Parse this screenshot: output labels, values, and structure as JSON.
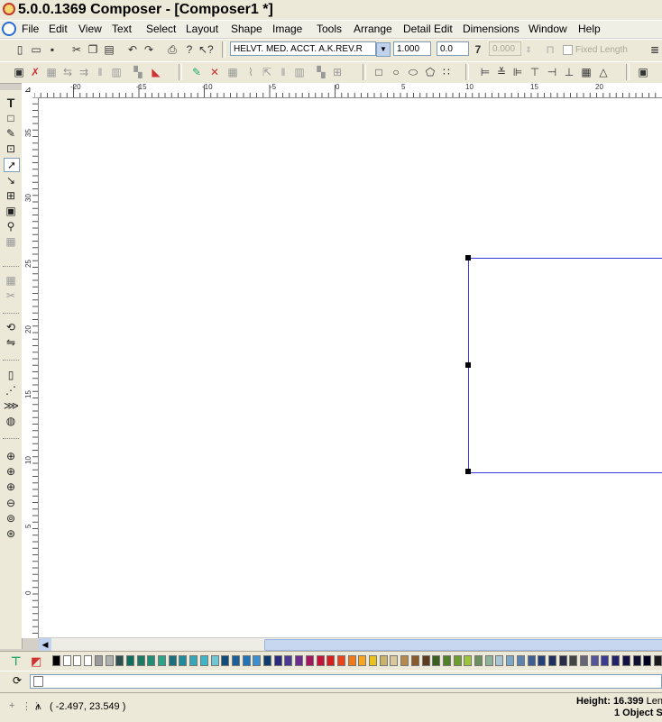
{
  "window": {
    "title": "5.0.0.1369 Composer - [Composer1 *]"
  },
  "menu": [
    "File",
    "Edit",
    "View",
    "Text",
    "Select",
    "Layout",
    "Shape",
    "Image",
    "Tools",
    "Arrange",
    "Detail Edit",
    "Dimensions",
    "Window",
    "Help"
  ],
  "toolbar": {
    "font_value": "HELVT. MED. ACCT. A.K.REV.R",
    "size_value": "1.000",
    "slant_value": "0.0",
    "spacing_value": "0.000",
    "fixed_length_label": "Fixed Length"
  },
  "ruler": {
    "h_labels": [
      "-20",
      "-15",
      "-10",
      "-5",
      "0",
      "5",
      "10",
      "15",
      "20"
    ],
    "v_labels": [
      "35",
      "30",
      "25",
      "20",
      "15",
      "10",
      "5",
      "0"
    ]
  },
  "palette": [
    "#000000",
    "#ffffff",
    "#ffffff",
    "#ffffff",
    "#9a9a9a",
    "#b0b0b0",
    "#2f4f4f",
    "#0e6e5b",
    "#1c7a64",
    "#208e74",
    "#2ca387",
    "#1b6e7a",
    "#1f8a99",
    "#33a6b8",
    "#3fb5c7",
    "#70c7d4",
    "#124d7a",
    "#1a5f99",
    "#2174b8",
    "#3b8fd1",
    "#0d3b6e",
    "#2a2a80",
    "#4a3a95",
    "#6b2d8f",
    "#a3185c",
    "#c4143b",
    "#d71e1e",
    "#e8431a",
    "#f07a1a",
    "#f5a623",
    "#e8c21a",
    "#c7b36b",
    "#d9c89e",
    "#b5884e",
    "#8b5a2b",
    "#5e3a1e",
    "#3a5f1e",
    "#4f7f26",
    "#6e9e2f",
    "#9cc43a",
    "#6d8f5e",
    "#8fb39a",
    "#a8c5d6",
    "#7da6c7",
    "#5b82b0",
    "#3d5f94",
    "#24407a",
    "#1e2e5e",
    "#2b2b4a",
    "#444444",
    "#666677",
    "#555599",
    "#3b3b8f",
    "#222266",
    "#111144",
    "#0f0f33",
    "#000022",
    "#1a1a1a"
  ],
  "status": {
    "coordinates": "( -2.497, 23.549 )",
    "height": "Height: 16.399",
    "length": "Len",
    "objects_selected": "1 Object Se"
  }
}
